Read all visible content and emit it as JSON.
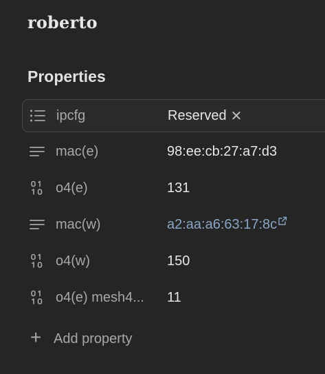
{
  "note": {
    "title": "roberto"
  },
  "properties": {
    "heading": "Properties",
    "items": [
      {
        "name": "ipcfg",
        "icon": "list-icon",
        "value": "Reserved",
        "type": "tag"
      },
      {
        "name": "mac(e)",
        "icon": "text-lines-icon",
        "value": "98:ee:cb:27:a7:d3",
        "type": "text"
      },
      {
        "name": "o4(e)",
        "icon": "binary-number-icon",
        "value": "131",
        "type": "number"
      },
      {
        "name": "mac(w)",
        "icon": "text-lines-icon",
        "value": "a2:aa:a6:63:17:8c",
        "type": "link"
      },
      {
        "name": "o4(w)",
        "icon": "binary-number-icon",
        "value": "150",
        "type": "number"
      },
      {
        "name": "o4(e) mesh4...",
        "icon": "binary-number-icon",
        "value": "11",
        "type": "number"
      }
    ],
    "add_label": "Add property"
  },
  "colors": {
    "background": "#252525",
    "link": "#8aa4c4",
    "muted": "#a8a8a8"
  }
}
